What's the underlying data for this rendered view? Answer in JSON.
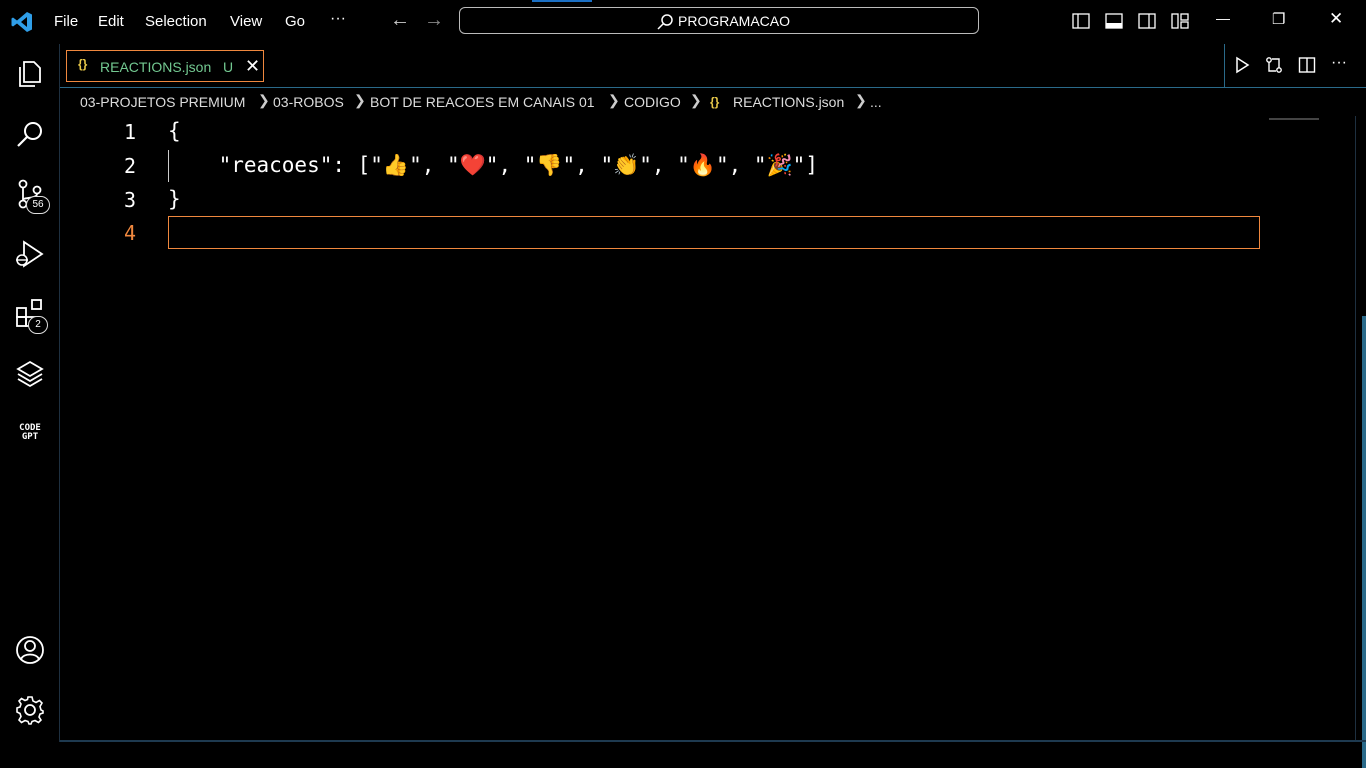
{
  "menu": [
    "File",
    "Edit",
    "Selection",
    "View",
    "Go",
    "···"
  ],
  "nav": {
    "back": "←",
    "forward": "→"
  },
  "command_center": {
    "text": "PROGRAMACAO",
    "icon": "search-icon"
  },
  "window_controls": {
    "minimize": "—",
    "restore": "❐",
    "close": "✕"
  },
  "activity_bar": {
    "items": [
      {
        "icon": "explorer-icon"
      },
      {
        "icon": "search-icon"
      },
      {
        "icon": "source-control-icon",
        "badge": "56"
      },
      {
        "icon": "run-debug-icon"
      },
      {
        "icon": "extensions-icon",
        "badge": "2"
      },
      {
        "icon": "layers-icon"
      },
      {
        "icon": "codegpt-icon",
        "label_line1": "CODE",
        "label_line2": "GPT"
      }
    ],
    "bottom": [
      {
        "icon": "account-icon"
      },
      {
        "icon": "settings-gear-icon"
      }
    ]
  },
  "tab": {
    "icon": "{}",
    "name": "REACTIONS.json",
    "status": "U",
    "close": "✕"
  },
  "breadcrumb": [
    "03-PROJETOS PREMIUM",
    "03-ROBOS",
    "BOT DE REACOES EM CANAIS 01",
    "CODIGO",
    "REACTIONS.json",
    "..."
  ],
  "editor": {
    "line_numbers": [
      "1",
      "2",
      "3",
      "4"
    ],
    "lines": [
      "{",
      "    \"reacoes\": [\"👍\", \"❤️\", \"👎\", \"👏\", \"🔥\", \"🎉\"]",
      "}",
      ""
    ],
    "current_line": "4"
  },
  "colors": {
    "accent": "#f0883e",
    "untracked": "#73c991",
    "border": "#2a6a8a"
  }
}
